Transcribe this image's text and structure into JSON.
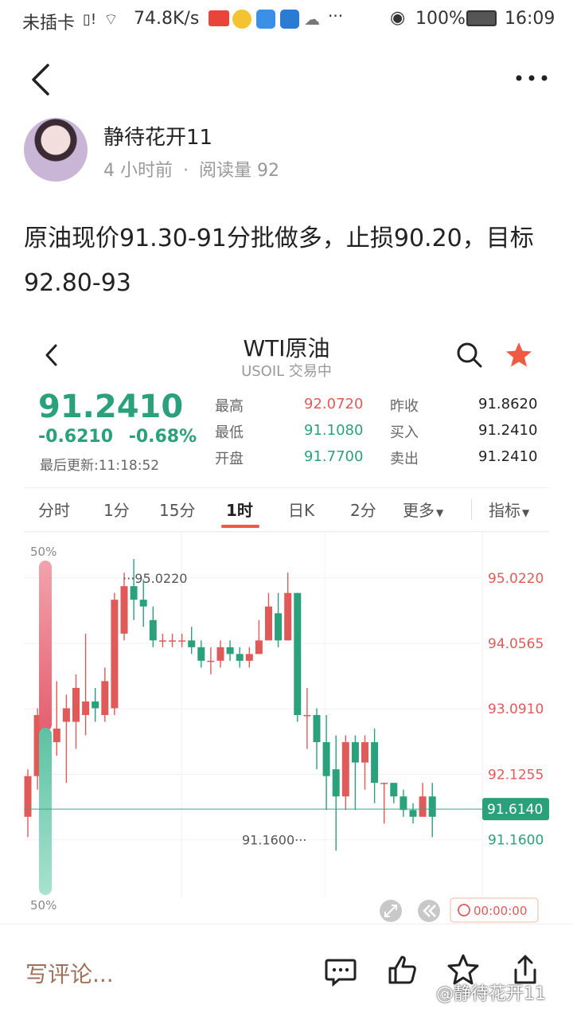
{
  "status_bar": {
    "carrier": "未插卡",
    "network_speed": "74.8K/s",
    "battery": "100%",
    "time": "16:09"
  },
  "post": {
    "author": "静待花开11",
    "time_ago": "4 小时前",
    "read_label": "阅读量 92",
    "body": "原油现价91.30-91分批做多，止损90.20，目标92.80-93"
  },
  "quote": {
    "title": "WTI原油",
    "subtitle": "USOIL 交易中",
    "price": "91.2410",
    "change": "-0.6210",
    "change_pct": "-0.68%",
    "updated": "最后更新:11:18:52",
    "stats": {
      "high_label": "最高",
      "high": "92.0720",
      "low_label": "最低",
      "low": "91.1080",
      "open_label": "开盘",
      "open": "91.7700",
      "prev_label": "昨收",
      "prev": "91.8620",
      "bid_label": "买入",
      "bid": "91.2410",
      "ask_label": "卖出",
      "ask": "91.2410"
    },
    "tabs": [
      "分时",
      "1分",
      "15分",
      "1时",
      "日K",
      "2分",
      "更多",
      "指标"
    ],
    "active_tab": "1时",
    "colors": {
      "up": "#e05a5a",
      "down": "#2aa17a",
      "accent": "#ef5a45"
    }
  },
  "chart_data": {
    "type": "candlestick",
    "y_tick_labels": [
      "95.0220",
      "94.0565",
      "93.0910",
      "92.1255",
      "91.1600"
    ],
    "current_label": "91.6140",
    "high_marker": "95.0220",
    "low_marker": "91.1600",
    "ratio_top": "50%",
    "ratio_bottom": "50%",
    "timer": "00:00:00",
    "ylim": [
      90.3,
      95.7
    ],
    "candles": [
      {
        "o": 91.5,
        "c": 92.1,
        "h": 92.2,
        "l": 91.2
      },
      {
        "o": 92.1,
        "c": 93.0,
        "h": 93.1,
        "l": 91.9
      },
      {
        "o": 92.9,
        "c": 92.8,
        "h": 93.3,
        "l": 92.5
      },
      {
        "o": 92.6,
        "c": 92.8,
        "h": 93.5,
        "l": 92.4
      },
      {
        "o": 92.9,
        "c": 93.1,
        "h": 93.3,
        "l": 92.0
      },
      {
        "o": 92.9,
        "c": 93.4,
        "h": 93.6,
        "l": 92.5
      },
      {
        "o": 93.0,
        "c": 93.2,
        "h": 94.2,
        "l": 92.7
      },
      {
        "o": 93.2,
        "c": 93.1,
        "h": 93.4,
        "l": 92.9
      },
      {
        "o": 93.0,
        "c": 93.5,
        "h": 93.7,
        "l": 92.9
      },
      {
        "o": 93.1,
        "c": 94.7,
        "h": 94.8,
        "l": 93.0
      },
      {
        "o": 94.2,
        "c": 94.9,
        "h": 95.1,
        "l": 94.1
      },
      {
        "o": 94.9,
        "c": 94.7,
        "h": 95.3,
        "l": 94.4
      },
      {
        "o": 94.7,
        "c": 94.6,
        "h": 95.0,
        "l": 94.3
      },
      {
        "o": 94.4,
        "c": 94.1,
        "h": 94.6,
        "l": 94.0
      },
      {
        "o": 94.1,
        "c": 94.1,
        "h": 94.2,
        "l": 94.0
      },
      {
        "o": 94.1,
        "c": 94.1,
        "h": 94.2,
        "l": 94.0
      },
      {
        "o": 94.1,
        "c": 94.1,
        "h": 94.2,
        "l": 94.0
      },
      {
        "o": 94.1,
        "c": 94.0,
        "h": 94.3,
        "l": 93.9
      },
      {
        "o": 94.0,
        "c": 93.8,
        "h": 94.1,
        "l": 93.7
      },
      {
        "o": 93.8,
        "c": 93.8,
        "h": 94.0,
        "l": 93.6
      },
      {
        "o": 93.8,
        "c": 94.0,
        "h": 94.1,
        "l": 93.7
      },
      {
        "o": 94.0,
        "c": 93.9,
        "h": 94.1,
        "l": 93.8
      },
      {
        "o": 93.9,
        "c": 93.8,
        "h": 94.0,
        "l": 93.7
      },
      {
        "o": 93.8,
        "c": 93.9,
        "h": 94.0,
        "l": 93.7
      },
      {
        "o": 93.9,
        "c": 94.1,
        "h": 94.4,
        "l": 93.9
      },
      {
        "o": 94.1,
        "c": 94.6,
        "h": 94.8,
        "l": 94.1
      },
      {
        "o": 94.5,
        "c": 94.1,
        "h": 94.8,
        "l": 94.0
      },
      {
        "o": 94.1,
        "c": 94.8,
        "h": 95.1,
        "l": 94.1
      },
      {
        "o": 94.8,
        "c": 93.0,
        "h": 94.8,
        "l": 92.9
      },
      {
        "o": 93.0,
        "c": 93.0,
        "h": 93.4,
        "l": 92.5
      },
      {
        "o": 93.0,
        "c": 92.6,
        "h": 93.1,
        "l": 92.2
      },
      {
        "o": 92.6,
        "c": 92.1,
        "h": 93.0,
        "l": 91.6
      },
      {
        "o": 92.2,
        "c": 91.8,
        "h": 92.7,
        "l": 91.0
      },
      {
        "o": 91.8,
        "c": 92.6,
        "h": 92.7,
        "l": 91.6
      },
      {
        "o": 92.6,
        "c": 92.3,
        "h": 92.7,
        "l": 91.6
      },
      {
        "o": 92.3,
        "c": 92.6,
        "h": 92.7,
        "l": 91.9
      },
      {
        "o": 92.6,
        "c": 92.0,
        "h": 92.8,
        "l": 91.7
      },
      {
        "o": 92.0,
        "c": 92.0,
        "h": 92.0,
        "l": 91.4
      },
      {
        "o": 92.0,
        "c": 91.8,
        "h": 92.0,
        "l": 91.7
      },
      {
        "o": 91.8,
        "c": 91.6,
        "h": 91.9,
        "l": 91.5
      },
      {
        "o": 91.6,
        "c": 91.5,
        "h": 91.7,
        "l": 91.4
      },
      {
        "o": 91.5,
        "c": 91.8,
        "h": 92.0,
        "l": 91.5
      },
      {
        "o": 91.8,
        "c": 91.5,
        "h": 92.0,
        "l": 91.2
      }
    ]
  },
  "bottom_bar": {
    "comment_placeholder": "写评论...",
    "watermark": "@静待花开11"
  }
}
